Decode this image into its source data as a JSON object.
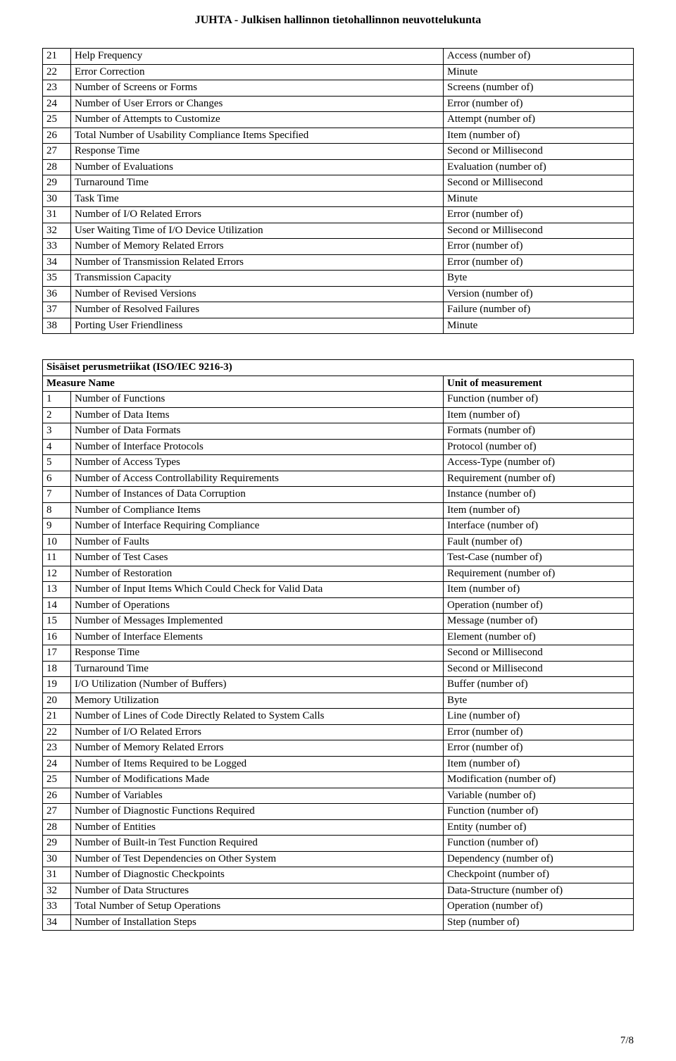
{
  "header": "JUHTA - Julkisen hallinnon tietohallinnon neuvottelukunta",
  "footer": "7/8",
  "table1": {
    "rows": [
      {
        "n": "21",
        "name": "Help Frequency",
        "unit": "Access (number of)"
      },
      {
        "n": "22",
        "name": "Error Correction",
        "unit": "Minute"
      },
      {
        "n": "23",
        "name": "Number of Screens or Forms",
        "unit": "Screens (number of)"
      },
      {
        "n": "24",
        "name": "Number of User Errors or Changes",
        "unit": "Error (number of)"
      },
      {
        "n": "25",
        "name": "Number of Attempts to Customize",
        "unit": "Attempt (number of)"
      },
      {
        "n": "26",
        "name": "Total Number of Usability Compliance Items Specified",
        "unit": "Item (number of)"
      },
      {
        "n": "27",
        "name": "Response Time",
        "unit": "Second or Millisecond"
      },
      {
        "n": "28",
        "name": "Number of Evaluations",
        "unit": "Evaluation (number of)"
      },
      {
        "n": "29",
        "name": "Turnaround Time",
        "unit": "Second or Millisecond"
      },
      {
        "n": "30",
        "name": "Task Time",
        "unit": "Minute"
      },
      {
        "n": "31",
        "name": "Number of I/O Related Errors",
        "unit": "Error (number of)"
      },
      {
        "n": "32",
        "name": "User Waiting Time of I/O Device Utilization",
        "unit": "Second or Millisecond"
      },
      {
        "n": "33",
        "name": "Number of Memory Related Errors",
        "unit": "Error (number of)"
      },
      {
        "n": "34",
        "name": "Number of Transmission Related Errors",
        "unit": "Error (number of)"
      },
      {
        "n": "35",
        "name": "Transmission Capacity",
        "unit": "Byte"
      },
      {
        "n": "36",
        "name": "Number of Revised Versions",
        "unit": "Version (number of)"
      },
      {
        "n": "37",
        "name": "Number of Resolved Failures",
        "unit": "Failure (number of)"
      },
      {
        "n": "38",
        "name": "Porting User Friendliness",
        "unit": "Minute"
      }
    ]
  },
  "table2": {
    "title": "Sisäiset perusmetriikat (ISO/IEC 9216-3)",
    "header_name": "Measure Name",
    "header_unit": "Unit of measurement",
    "rows": [
      {
        "n": "1",
        "name": "Number of Functions",
        "unit": "Function (number of)"
      },
      {
        "n": "2",
        "name": "Number of Data Items",
        "unit": "Item (number of)"
      },
      {
        "n": "3",
        "name": "Number of Data Formats",
        "unit": "Formats (number of)"
      },
      {
        "n": "4",
        "name": "Number of Interface Protocols",
        "unit": "Protocol (number of)"
      },
      {
        "n": "5",
        "name": "Number of Access Types",
        "unit": "Access-Type (number of)"
      },
      {
        "n": "6",
        "name": "Number of Access Controllability Requirements",
        "unit": "Requirement (number of)"
      },
      {
        "n": "7",
        "name": "Number of Instances of Data Corruption",
        "unit": "Instance (number of)"
      },
      {
        "n": "8",
        "name": "Number of Compliance Items",
        "unit": "Item (number of)"
      },
      {
        "n": "9",
        "name": "Number of Interface Requiring Compliance",
        "unit": "Interface (number of)"
      },
      {
        "n": "10",
        "name": "Number of Faults",
        "unit": "Fault (number of)"
      },
      {
        "n": "11",
        "name": "Number of Test Cases",
        "unit": "Test-Case (number of)"
      },
      {
        "n": "12",
        "name": "Number of Restoration",
        "unit": "Requirement (number of)"
      },
      {
        "n": "13",
        "name": "Number of Input Items Which Could Check for Valid Data",
        "unit": "Item (number of)"
      },
      {
        "n": "14",
        "name": "Number of Operations",
        "unit": "Operation (number of)"
      },
      {
        "n": "15",
        "name": "Number of Messages Implemented",
        "unit": "Message (number of)"
      },
      {
        "n": "16",
        "name": "Number of Interface Elements",
        "unit": "Element (number of)"
      },
      {
        "n": "17",
        "name": "Response Time",
        "unit": "Second or Millisecond"
      },
      {
        "n": "18",
        "name": "Turnaround Time",
        "unit": "Second or Millisecond"
      },
      {
        "n": "19",
        "name": "I/O Utilization (Number of Buffers)",
        "unit": "Buffer (number of)"
      },
      {
        "n": "20",
        "name": "Memory Utilization",
        "unit": "Byte"
      },
      {
        "n": "21",
        "name": "Number of Lines of Code Directly Related to System Calls",
        "unit": "Line (number of)"
      },
      {
        "n": "22",
        "name": "Number of I/O Related Errors",
        "unit": "Error (number of)"
      },
      {
        "n": "23",
        "name": "Number of Memory Related Errors",
        "unit": "Error (number of)"
      },
      {
        "n": "24",
        "name": "Number of Items Required to be Logged",
        "unit": "Item (number of)"
      },
      {
        "n": "25",
        "name": "Number of Modifications Made",
        "unit": "Modification (number of)"
      },
      {
        "n": "26",
        "name": "Number of Variables",
        "unit": "Variable (number of)"
      },
      {
        "n": "27",
        "name": "Number of Diagnostic Functions Required",
        "unit": "Function (number of)"
      },
      {
        "n": "28",
        "name": "Number of Entities",
        "unit": "Entity (number of)"
      },
      {
        "n": "29",
        "name": "Number of Built-in Test Function Required",
        "unit": "Function (number of)"
      },
      {
        "n": "30",
        "name": "Number of Test Dependencies on Other System",
        "unit": "Dependency (number of)"
      },
      {
        "n": "31",
        "name": "Number of Diagnostic Checkpoints",
        "unit": "Checkpoint (number of)"
      },
      {
        "n": "32",
        "name": "Number of Data Structures",
        "unit": "Data-Structure (number of)"
      },
      {
        "n": "33",
        "name": "Total Number of Setup Operations",
        "unit": "Operation (number of)"
      },
      {
        "n": "34",
        "name": "Number of Installation Steps",
        "unit": "Step (number of)"
      }
    ]
  }
}
